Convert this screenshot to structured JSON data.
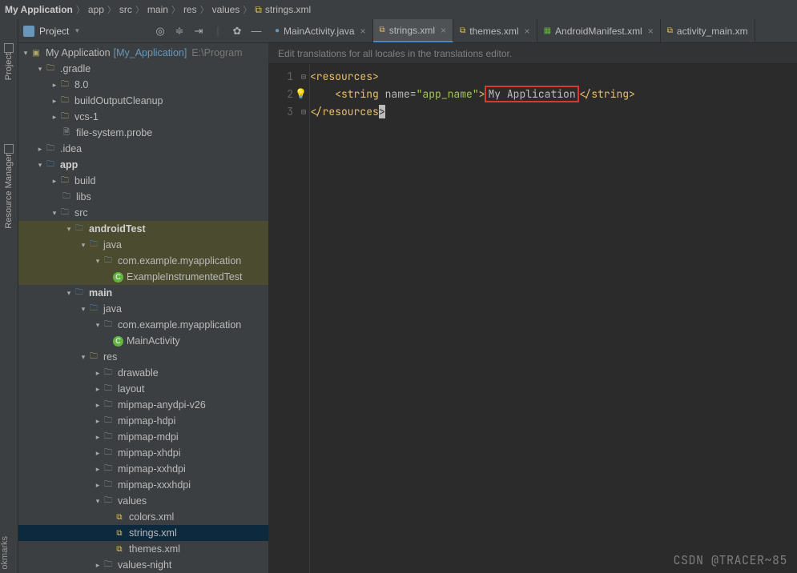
{
  "breadcrumb": {
    "items": [
      "My Application",
      "app",
      "src",
      "main",
      "res",
      "values",
      "strings.xml"
    ]
  },
  "leftRail": {
    "project": "Project",
    "resmgr": "Resource Manager",
    "bookmarks": "okmarks"
  },
  "panel": {
    "title": "Project"
  },
  "tree": {
    "root": "My Application",
    "rootBracket": "[My_Application]",
    "rootPath": "E:\\Program",
    "gradle": ".gradle",
    "v80": "8.0",
    "buildOutput": "buildOutputCleanup",
    "vcs": "vcs-1",
    "probe": "file-system.probe",
    "idea": ".idea",
    "app": "app",
    "build": "build",
    "libs": "libs",
    "src": "src",
    "androidTest": "androidTest",
    "java1": "java",
    "pkg1": "com.example.myapplication",
    "test1": "ExampleInstrumentedTest",
    "mainDir": "main",
    "java2": "java",
    "pkg2": "com.example.myapplication",
    "act": "MainActivity",
    "res": "res",
    "drawable": "drawable",
    "layout": "layout",
    "m1": "mipmap-anydpi-v26",
    "m2": "mipmap-hdpi",
    "m3": "mipmap-mdpi",
    "m4": "mipmap-xhdpi",
    "m5": "mipmap-xxhdpi",
    "m6": "mipmap-xxxhdpi",
    "values": "values",
    "colors": "colors.xml",
    "strings": "strings.xml",
    "themes": "themes.xml",
    "valuesNight": "values-night"
  },
  "tabs": {
    "t0": "MainActivity.java",
    "t1": "strings.xml",
    "t2": "themes.xml",
    "t3": "AndroidManifest.xml",
    "t4": "activity_main.xm"
  },
  "hint": "Edit translations for all locales in the translations editor.",
  "code": {
    "ln1": "1",
    "ln2": "2",
    "ln3": "3",
    "resOpen": "<resources>",
    "indent": "    ",
    "strOpen1": "<string ",
    "nameAttr": "name=",
    "nameVal": "\"app_name\"",
    "gt": ">",
    "appText": "My Application",
    "strClose": "</string>",
    "resClose1": "</resources",
    "resClose2": ">"
  },
  "watermark": "CSDN @TRACER~85"
}
